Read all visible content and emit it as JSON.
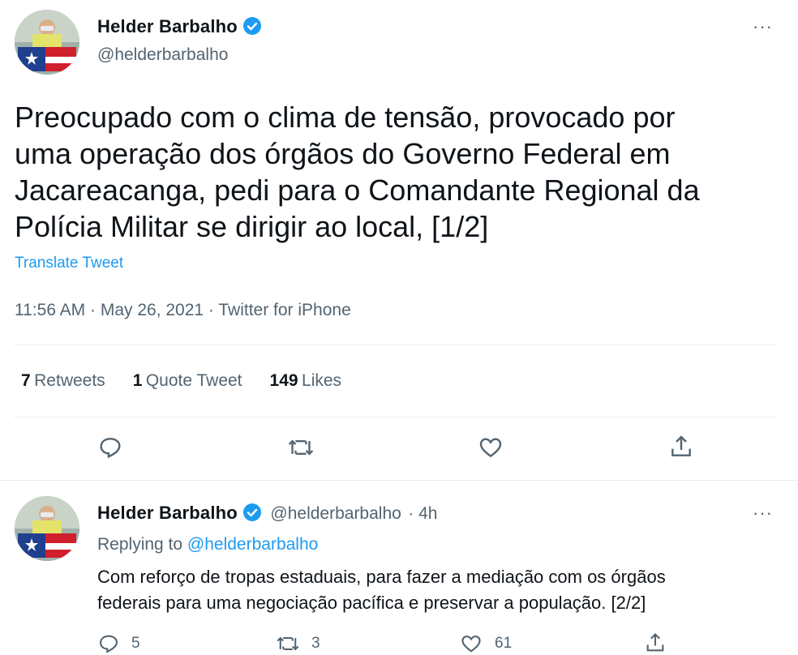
{
  "main_tweet": {
    "author": {
      "name": "Helder Barbalho",
      "handle": "@helderbarbalho"
    },
    "text_lines": [
      "Preocupado com o clima de tensão, provocado por",
      "uma operação dos órgãos do Governo Federal em",
      "Jacareacanga, pedi para o Comandante Regional da",
      "Polícia Militar se dirigir ao local, [1/2]"
    ],
    "translate_label": "Translate Tweet",
    "meta": "11:56 AM · May 26, 2021 · Twitter for iPhone",
    "stats": {
      "retweets": {
        "count": "7",
        "label": "Retweets"
      },
      "quotes": {
        "count": "1",
        "label": "Quote Tweet"
      },
      "likes": {
        "count": "149",
        "label": "Likes"
      }
    },
    "actions": {
      "reply_icon": "reply-icon",
      "retweet_icon": "retweet-icon",
      "like_icon": "heart-icon",
      "share_icon": "share-icon"
    }
  },
  "reply_tweet": {
    "author": {
      "name": "Helder Barbalho",
      "handle": "@helderbarbalho",
      "time": "· 4h"
    },
    "replying_prefix": "Replying to",
    "replying_handle": "@helderbarbalho",
    "text_lines": [
      "Com reforço de tropas estaduais, para fazer a mediação com os órgãos",
      "federais para uma negociação pacífica e preservar a população. [2/2]"
    ],
    "counts": {
      "replies": "5",
      "retweets": "3",
      "likes": "61"
    }
  },
  "more_label": "···",
  "colors": {
    "accent": "#1d9bf0",
    "muted": "#536471",
    "text": "#0f1419",
    "divider": "#e6ecf0"
  }
}
